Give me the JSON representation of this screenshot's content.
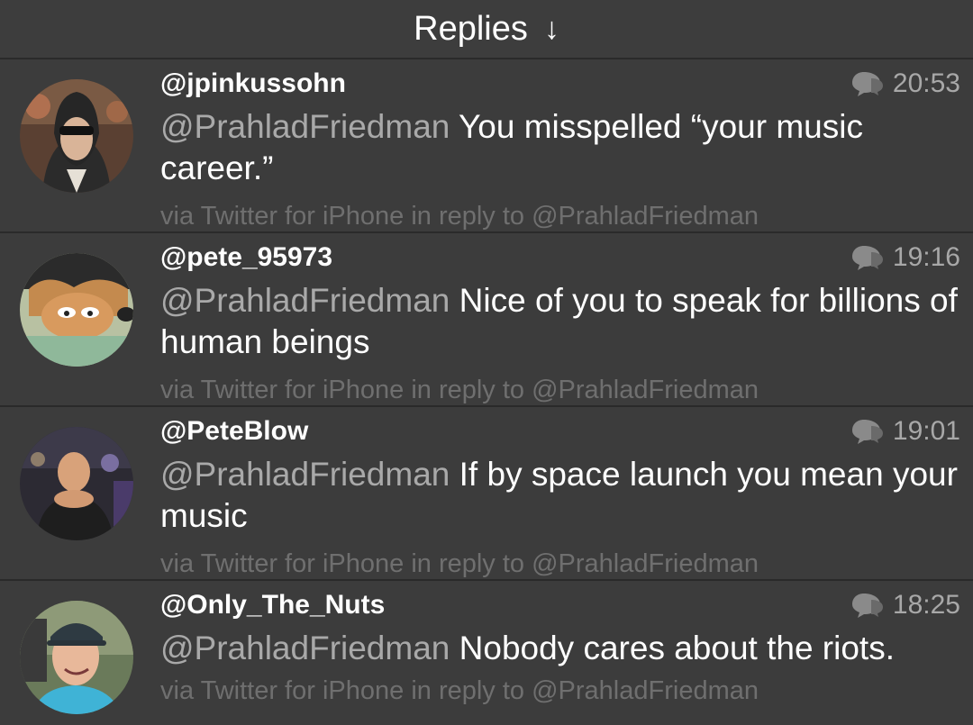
{
  "header": {
    "title": "Replies",
    "arrow": "↓"
  },
  "replies": [
    {
      "username": "@jpinkussohn",
      "time": "20:53",
      "mention": "@PrahladFriedman",
      "text": " You misspelled “your music career.”",
      "via": "via Twitter for iPhone in reply to @PrahladFriedman"
    },
    {
      "username": "@pete_95973",
      "time": "19:16",
      "mention": "@PrahladFriedman",
      "text": " Nice of you to speak for billions of human beings",
      "via": "via Twitter for iPhone in reply to @PrahladFriedman"
    },
    {
      "username": "@PeteBlow",
      "time": "19:01",
      "mention": "@PrahladFriedman",
      "text": " If by space launch you mean your music",
      "via": "via Twitter for iPhone in reply to @PrahladFriedman"
    },
    {
      "username": "@Only_The_Nuts",
      "time": "18:25",
      "mention": "@PrahladFriedman",
      "text": " Nobody cares about the riots.",
      "via": "via Twitter for iPhone in reply to @PrahladFriedman"
    }
  ]
}
